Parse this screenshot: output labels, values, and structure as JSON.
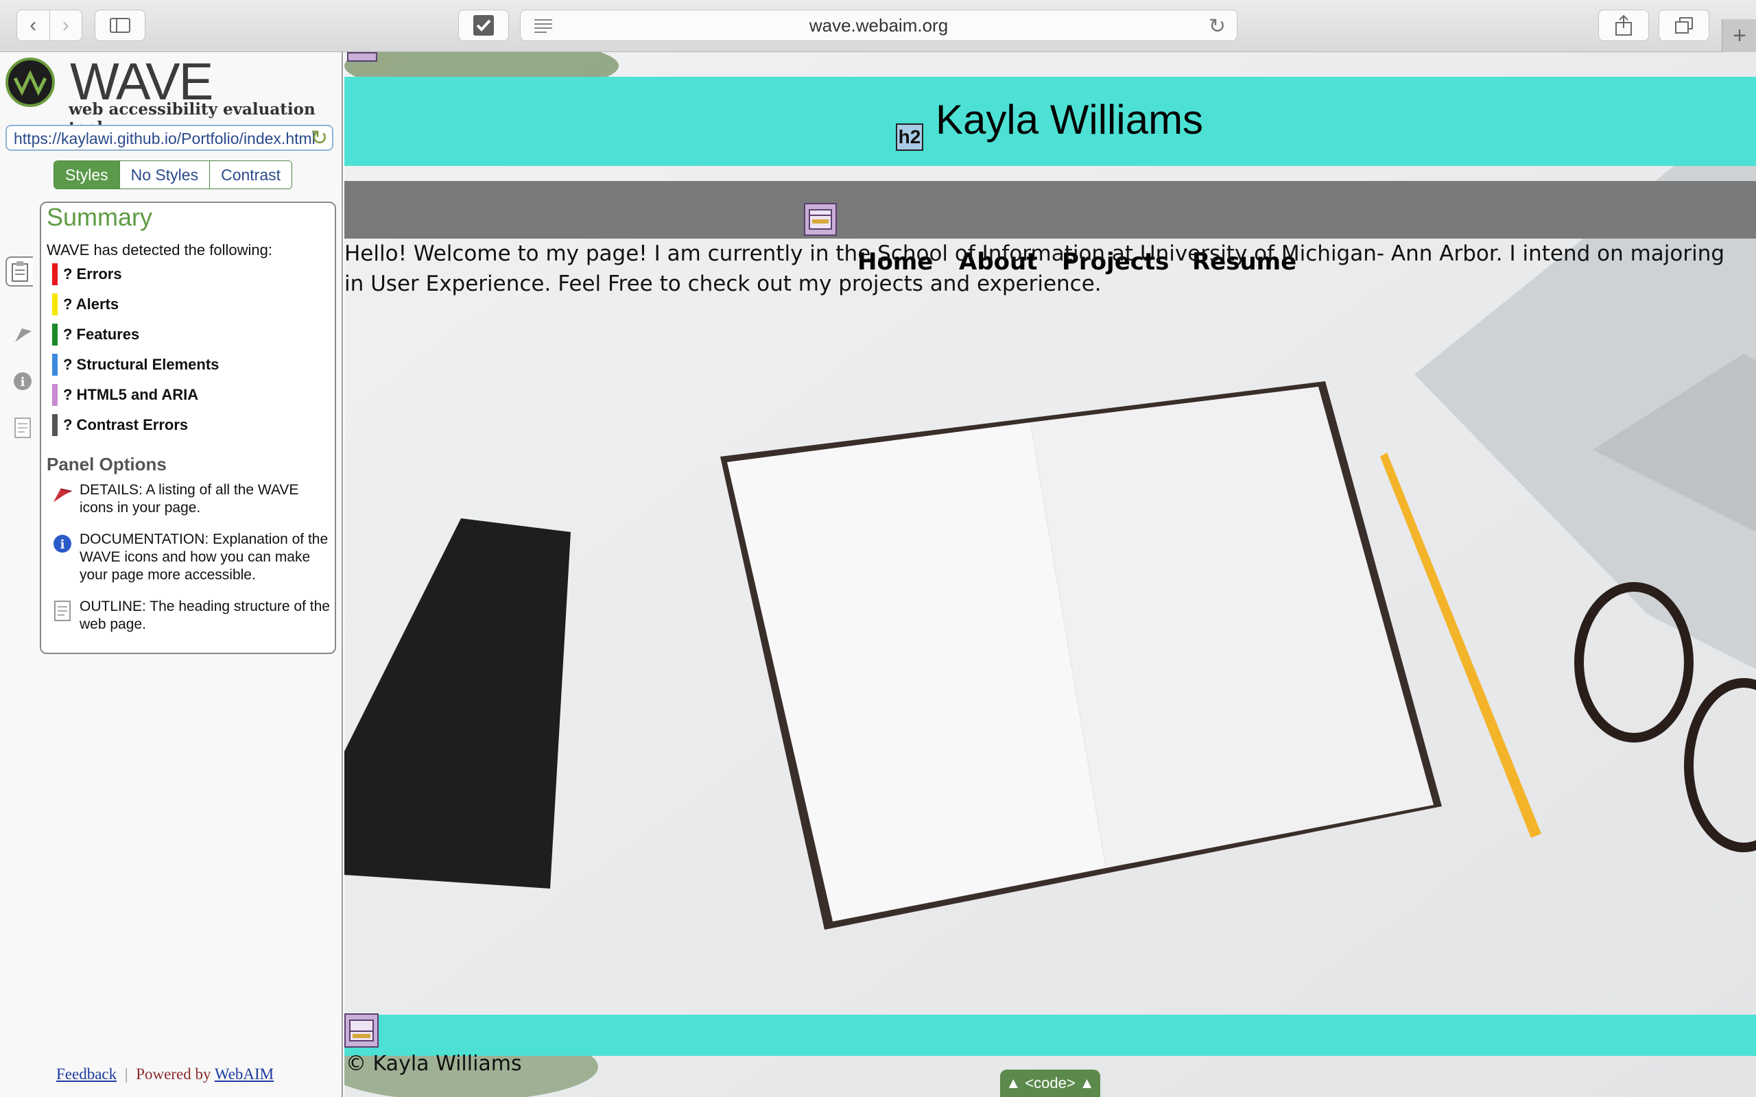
{
  "browser": {
    "address": "wave.webaim.org",
    "icons": {
      "back": "chevron-left-icon",
      "forward": "chevron-right-icon",
      "sidebar": "sidebar-icon",
      "extension": "checkmark-icon",
      "reader": "reader-icon",
      "reload": "reload-icon",
      "share": "share-icon",
      "tabs": "tabs-overview-icon",
      "new_tab": "plus-icon"
    }
  },
  "wave": {
    "title": "WAVE",
    "subtitle": "web accessibility evaluation tool",
    "url_value": "https://kaylawi.github.io/Portfolio/index.html",
    "view_tabs": [
      "Styles",
      "No Styles",
      "Contrast"
    ],
    "active_view": "Styles",
    "summary_heading": "Summary",
    "detected_text": "WAVE has detected the following:",
    "summary_items": [
      {
        "label": "? Errors",
        "color": "#e8171c"
      },
      {
        "label": "? Alerts",
        "color": "#f5e60a"
      },
      {
        "label": "? Features",
        "color": "#1c8a2a"
      },
      {
        "label": "? Structural Elements",
        "color": "#3a8ae0"
      },
      {
        "label": "? HTML5 and ARIA",
        "color": "#c88ad0"
      },
      {
        "label": "? Contrast Errors",
        "color": "#555555"
      }
    ],
    "panel_options_heading": "Panel Options",
    "panel_options": [
      "DETAILS: A listing of all the WAVE icons in your page.",
      "DOCUMENTATION: Explanation of the WAVE icons and how you can make your page more accessible.",
      "OUTLINE: The heading structure of the web page."
    ],
    "footer_feedback": "Feedback",
    "footer_separator": "|",
    "footer_powered": "Powered by",
    "footer_webaim": "WebAIM"
  },
  "site": {
    "name": "Kayla Williams",
    "h2_badge": "h2",
    "nav": [
      "Home",
      "About",
      "Projects",
      "Resume"
    ],
    "intro": "Hello! Welcome to my page! I am currently in the School of Information at University of Michigan- Ann Arbor. I intend on majoring in User Experience. Feel Free to check out my projects and experience.",
    "copyright": "© Kayla Williams",
    "code_toggle": "▲ <code> ▲"
  },
  "colors": {
    "banner": "#4ce1d4",
    "navbar": "#7a7a7a",
    "wave_green": "#5d9b42"
  }
}
